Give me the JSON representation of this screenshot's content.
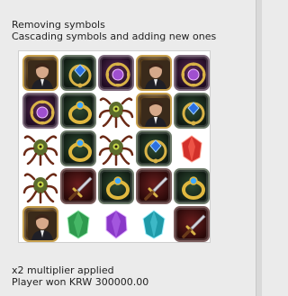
{
  "captions": {
    "line1": "Removing symbols",
    "line2": "Cascading symbols and adding new ones",
    "multiplier": "x2 multiplier applied",
    "win": "Player won KRW 300000.00"
  },
  "board": {
    "rows": [
      [
        "portrait",
        "blue-gem-pendant",
        "purple-gem-pendant",
        "portrait",
        "purple-gem-pendant"
      ],
      [
        "purple-gem-pendant",
        "gold-ring",
        "tentacle-monster",
        "portrait",
        "blue-gem-pendant"
      ],
      [
        "tentacle-monster",
        "gold-ring",
        "tentacle-monster",
        "blue-gem-pendant",
        "red-crystal"
      ],
      [
        "tentacle-monster",
        "dagger",
        "gold-ring",
        "dagger",
        "gold-ring"
      ],
      [
        "portrait",
        "green-crystal",
        "purple-crystal",
        "teal-crystal",
        "dagger"
      ]
    ]
  },
  "colors": {
    "background": "#ebebeb",
    "board": "#ffffff",
    "text": "#222222"
  }
}
